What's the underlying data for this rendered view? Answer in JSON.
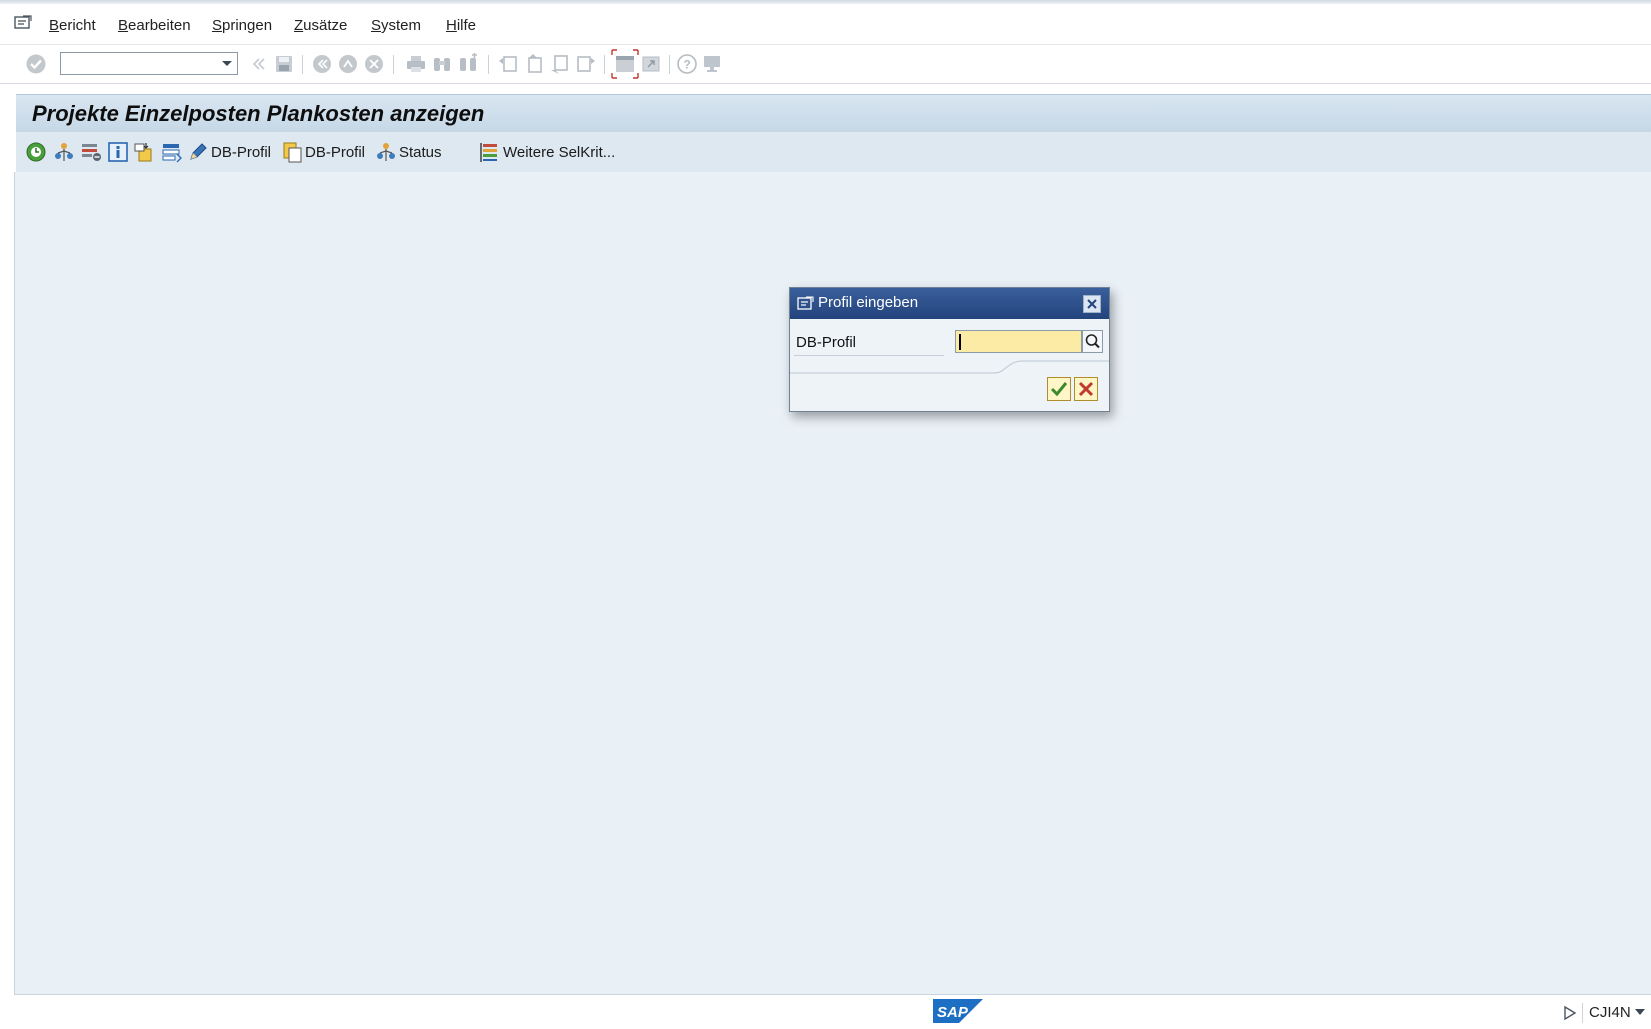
{
  "menubar": {
    "items": [
      {
        "prefix": "",
        "mnemonic": "B",
        "rest": "ericht"
      },
      {
        "prefix": "",
        "mnemonic": "B",
        "rest": "earbeiten"
      },
      {
        "prefix": "",
        "mnemonic": "S",
        "rest": "pringen"
      },
      {
        "prefix": "",
        "mnemonic": "Z",
        "rest": "usätze"
      },
      {
        "prefix": "",
        "mnemonic": "S",
        "rest": "ystem"
      },
      {
        "prefix": "",
        "mnemonic": "H",
        "rest": "ilfe"
      }
    ]
  },
  "system_toolbar": {
    "command_field_value": "",
    "icons": [
      "enter-icon",
      "command-dropdown-icon",
      "back-icon",
      "save-icon",
      "back-green-icon",
      "exit-icon",
      "cancel-icon",
      "print-icon",
      "find-icon",
      "find-next-icon",
      "first-page-icon",
      "previous-page-icon",
      "next-page-icon",
      "last-page-icon",
      "create-session-icon",
      "shortcut-icon",
      "help-icon",
      "customize-layout-icon"
    ]
  },
  "page": {
    "title": "Projekte Einzelposten Plankosten anzeigen"
  },
  "app_toolbar": {
    "buttons": [
      {
        "icon": "execute-icon",
        "label": ""
      },
      {
        "icon": "hierarchy-icon",
        "label": ""
      },
      {
        "icon": "delete-selection-icon",
        "label": ""
      },
      {
        "icon": "info-icon",
        "label": ""
      },
      {
        "icon": "get-variant-icon",
        "label": ""
      },
      {
        "icon": "selection-options-icon",
        "label": ""
      },
      {
        "icon": "pencil-icon",
        "label": "DB-Profil"
      },
      {
        "icon": "profile-copy-icon",
        "label": "DB-Profil"
      },
      {
        "icon": "status-icon",
        "label": "Status"
      },
      {
        "icon": "further-criteria-icon",
        "label": "Weitere SelKrit..."
      }
    ]
  },
  "dialog": {
    "title": "Profil eingeben",
    "field_label": "DB-Profil",
    "field_value": "",
    "ok_icon": "checkmark-icon",
    "cancel_icon": "cancel-x-icon"
  },
  "footer": {
    "logo": "SAP",
    "transaction": "CJI4N"
  },
  "colors": {
    "title_band": "#c5d7e6",
    "workspace": "#e9f0f6",
    "dialog_header": "#23437d",
    "input_required": "#fbeba5"
  }
}
